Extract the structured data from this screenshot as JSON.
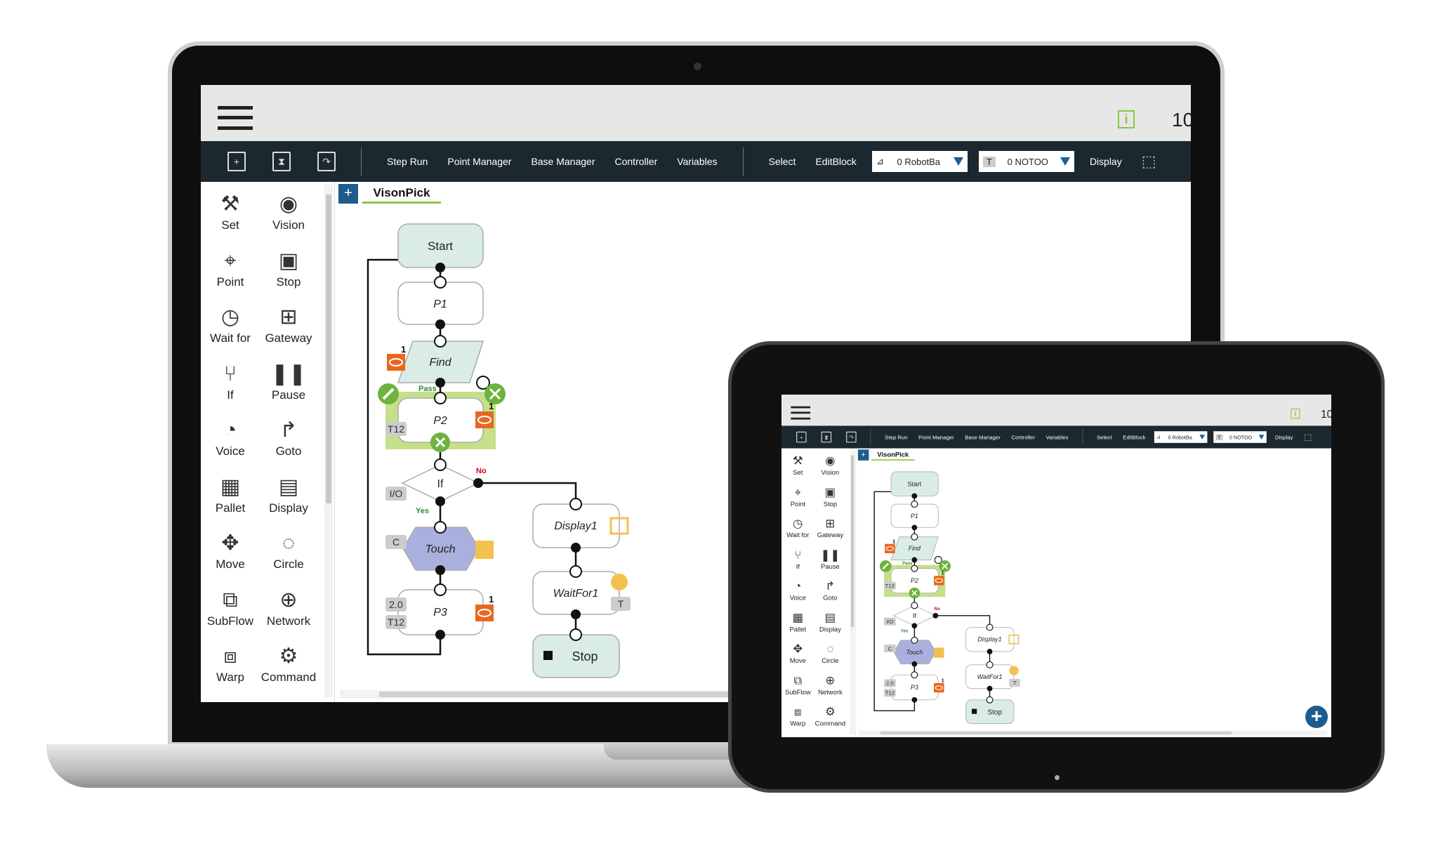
{
  "topbar": {
    "info_icon": "info-icon",
    "count": "10"
  },
  "toolbar": {
    "file_icons": [
      "new-file-icon",
      "save-file-icon",
      "open-file-icon"
    ],
    "items": [
      "Step Run",
      "Point Manager",
      "Base Manager",
      "Controller",
      "Variables"
    ],
    "items2": [
      "Select",
      "EditBlock"
    ],
    "robot_base": "0 RobotBa",
    "tool": "0 NOTOO",
    "tool_prefix": "T",
    "display": "Display"
  },
  "palette": [
    {
      "label": "Set",
      "icon": "set-icon"
    },
    {
      "label": "Vision",
      "icon": "eye-icon"
    },
    {
      "label": "Point",
      "icon": "point-icon"
    },
    {
      "label": "Stop",
      "icon": "stop-icon"
    },
    {
      "label": "Wait for",
      "icon": "clock-icon"
    },
    {
      "label": "Gateway",
      "icon": "gateway-icon"
    },
    {
      "label": "If",
      "icon": "branch-icon"
    },
    {
      "label": "Pause",
      "icon": "pause-icon"
    },
    {
      "label": "Voice",
      "icon": "voice-icon"
    },
    {
      "label": "Goto",
      "icon": "goto-icon"
    },
    {
      "label": "Pallet",
      "icon": "grid-icon"
    },
    {
      "label": "Display",
      "icon": "display-icon"
    },
    {
      "label": "Move",
      "icon": "move-icon"
    },
    {
      "label": "Circle",
      "icon": "circle-icon"
    },
    {
      "label": "SubFlow",
      "icon": "subflow-icon"
    },
    {
      "label": "Network",
      "icon": "globe-icon"
    },
    {
      "label": "Warp",
      "icon": "warp-icon"
    },
    {
      "label": "Command",
      "icon": "command-icon"
    }
  ],
  "tab": {
    "add": "+",
    "name": "VisonPick"
  },
  "flow": {
    "start": "Start",
    "p1": "P1",
    "find": "Find",
    "p2": "P2",
    "if": "If",
    "touch": "Touch",
    "p3": "P3",
    "display1": "Display1",
    "waitfor1": "WaitFor1",
    "stop": "Stop",
    "pass": "Pass",
    "no": "No",
    "yes": "Yes",
    "one": "1",
    "t12": "T12",
    "io": "I/O",
    "c": "C",
    "speed": "2.0",
    "t": "T"
  },
  "colors": {
    "toolbar": "#1c2830",
    "accent_green": "#8cc63f",
    "badge_orange": "#e8671e",
    "badge_yellow": "#f2c14e",
    "touch_node": "#a9b0dd",
    "start_node": "#d9ede6",
    "tab_blue": "#1d5c8b"
  }
}
